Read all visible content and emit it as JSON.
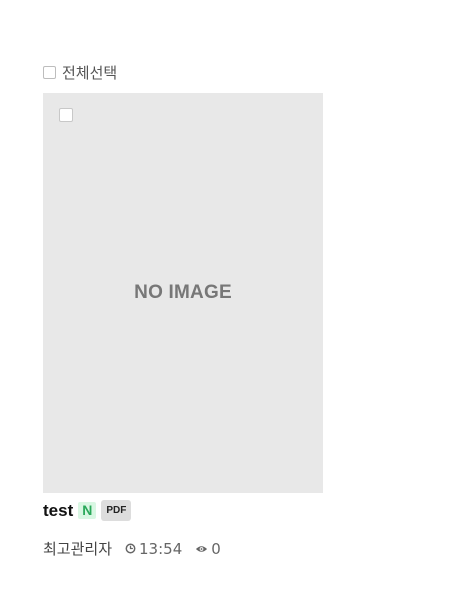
{
  "list": {
    "select_all_label": "전체선택"
  },
  "card": {
    "thumbnail_text": "NO IMAGE",
    "title": "test",
    "badge_new": "N",
    "badge_file": "PDF",
    "author": "최고관리자",
    "time": "13:54",
    "views": "0"
  },
  "icons": {
    "time": "clock-icon",
    "views": "eye-icon"
  },
  "colors": {
    "thumbnail_bg": "#e8e8e8",
    "new_badge": "#58e08a",
    "pdf_badge_bg": "#dddddd"
  }
}
